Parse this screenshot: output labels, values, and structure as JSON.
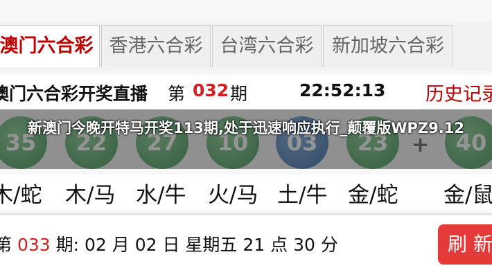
{
  "tabs": [
    {
      "label": "澳门六合彩",
      "active": true
    },
    {
      "label": "香港六合彩",
      "active": false
    },
    {
      "label": "台湾六合彩",
      "active": false
    },
    {
      "label": "新加坡六合彩",
      "active": false
    }
  ],
  "live": {
    "title": "澳门六合彩开奖直播",
    "issue_prefix": "第",
    "issue_number": "032",
    "issue_suffix": "期",
    "time": "22:52:13",
    "history_label": "历史记录"
  },
  "balls": [
    {
      "number": "35",
      "color": "#2e8b46"
    },
    {
      "number": "22",
      "color": "#2e8b46"
    },
    {
      "number": "27",
      "color": "#2e8b46"
    },
    {
      "number": "10",
      "color": "#2e8b46"
    },
    {
      "number": "03",
      "color": "#2c5f9e"
    },
    {
      "number": "23",
      "color": "#2e8b46"
    },
    {
      "number": "40",
      "color": "#2e8b46"
    }
  ],
  "plus_sign": "+",
  "zodiac": [
    "木/蛇",
    "木/马",
    "水/牛",
    "火/马",
    "土/牛",
    "金/蛇",
    "金/鼠"
  ],
  "next_draw": {
    "issue_prefix": "第",
    "issue_number": "033",
    "text": "期: 02 月 02 日 星期五 21 点 30 分"
  },
  "refresh_label": "刷 新",
  "overlay_headline": "新澳门今晚开特马开奖113期,处于迅速响应执行_颠覆版WPZ9.12",
  "colors": {
    "accent": "#c00000",
    "refresh": "#e43a3a"
  }
}
